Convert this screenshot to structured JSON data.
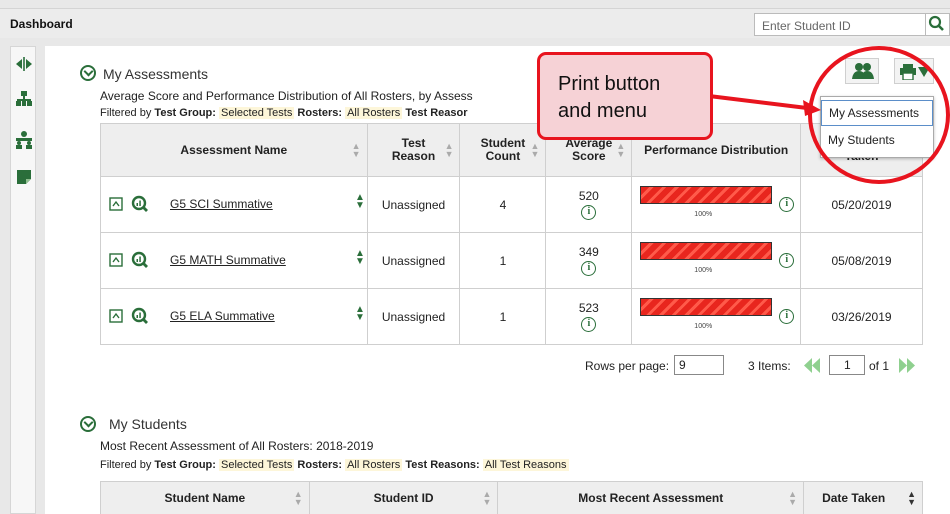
{
  "header": {
    "title": "Dashboard",
    "search_placeholder": "Enter Student ID"
  },
  "sidebar": {
    "icons": [
      "expand-collapse-icon",
      "hierarchy-icon",
      "roster-icon",
      "note-icon"
    ]
  },
  "assessments": {
    "title": "My Assessments",
    "subtitle": "Average Score and Performance Distribution of All Rosters, by Assess",
    "filter": {
      "prefix": "Filtered by",
      "group_label": "Test Group:",
      "group_value": "Selected Tests",
      "rosters_label": "Rosters:",
      "rosters_value": "All Rosters",
      "reason_label": "Test Reasor"
    },
    "columns": [
      "Assessment Name",
      "Test",
      "Reason",
      "Student",
      "Count",
      "Average",
      "Score",
      "Performance Distribution",
      "Taken"
    ],
    "rows": [
      {
        "name": "G5 SCI Summative",
        "reason": "Unassigned",
        "count": "4",
        "score": "520",
        "pct": "100%",
        "date": "05/20/2019"
      },
      {
        "name": "G5 MATH Summative",
        "reason": "Unassigned",
        "count": "1",
        "score": "349",
        "pct": "100%",
        "date": "05/08/2019"
      },
      {
        "name": "G5 ELA Summative",
        "reason": "Unassigned",
        "count": "1",
        "score": "523",
        "pct": "100%",
        "date": "03/26/2019"
      }
    ],
    "rows_per_page_label": "Rows per page:",
    "rows_per_page": "9",
    "items_label": "3 Items:",
    "page": "1",
    "page_of": "of 1"
  },
  "students": {
    "title": "My Students",
    "subtitle": "Most Recent Assessment of All Rosters: 2018-2019",
    "filter": {
      "prefix": "Filtered by",
      "group_label": "Test Group:",
      "group_value": "Selected Tests",
      "rosters_label": "Rosters:",
      "rosters_value": "All Rosters",
      "reasons_label": "Test Reasons:",
      "reasons_value": "All Test Reasons"
    },
    "columns": [
      "Student Name",
      "Student ID",
      "Most Recent Assessment",
      "Date Taken"
    ]
  },
  "print_menu": {
    "items": [
      "My Assessments",
      "My Students"
    ]
  },
  "callout": {
    "line1": "Print button",
    "line2": "and menu"
  },
  "colors": {
    "accent_green": "#2a6e3a",
    "callout_red": "#e8141e",
    "bar_red": "#e8261e"
  }
}
